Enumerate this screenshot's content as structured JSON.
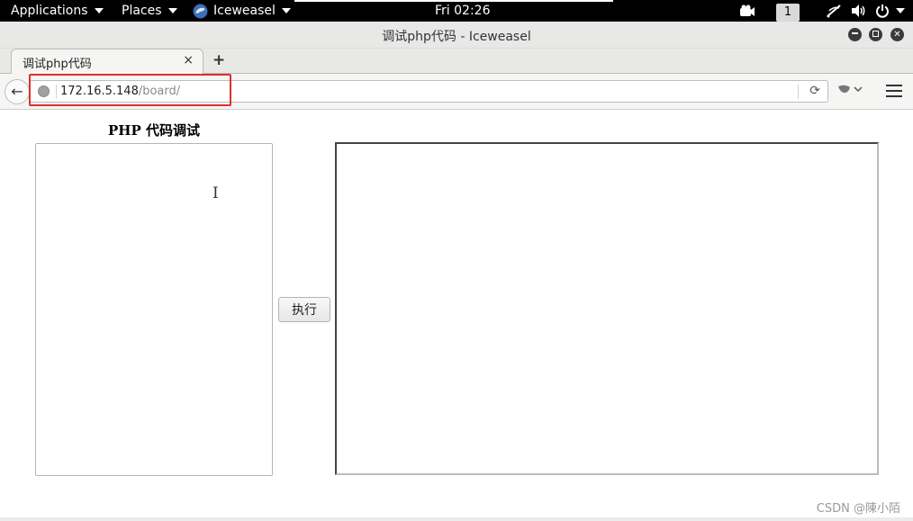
{
  "topbar": {
    "applications": "Applications",
    "places": "Places",
    "browser_name": "Iceweasel",
    "clock": "Fri 02:26",
    "workspace": "1"
  },
  "window": {
    "title": "调试php代码 - Iceweasel"
  },
  "tabs": [
    {
      "label": "调试php代码",
      "close": "×"
    }
  ],
  "newtab": "+",
  "navbar": {
    "back": "←",
    "url_host": "172.16.5.148",
    "url_path": "/board/",
    "reload": "⟳"
  },
  "page": {
    "heading": "PHP 代码调试",
    "execute_label": "执行",
    "code_value": ""
  },
  "watermark": "CSDN @陳小陌",
  "colors": {
    "highlight_box": "#e0302a"
  },
  "icons": {
    "camera": "camera-icon",
    "wireless": "wireless-icon",
    "volume": "volume-icon",
    "power": "power-icon"
  }
}
